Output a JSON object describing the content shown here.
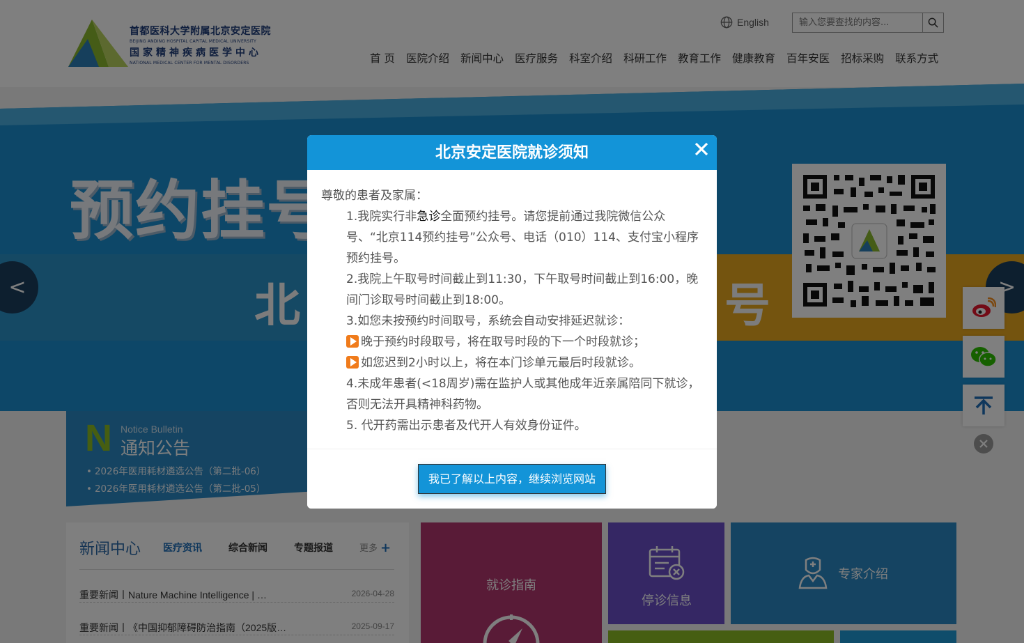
{
  "header": {
    "logo": {
      "cn_line1": "首都医科大学附属北京安定医院",
      "en_line1": "BEIJING ANDING HOSPITAL CAPITAL MEDICAL UNIVERSITY",
      "cn_line2": "国家精神疾病医学中心",
      "en_line2": "NATIONAL MEDICAL CENTER FOR MENTAL DISORDERS"
    },
    "language_label": "English",
    "search_placeholder": "输入您要查找的内容...",
    "nav": [
      "首 页",
      "医院介绍",
      "新闻中心",
      "医疗服务",
      "科室介绍",
      "科研工作",
      "教育工作",
      "健康教育",
      "百年安医",
      "招标采购",
      "联系方式"
    ]
  },
  "banner": {
    "title": "预约挂号",
    "subtitle_start": "北",
    "subtitle_end": "号",
    "prev_label": "<",
    "next_label": ">"
  },
  "notice": {
    "letter": "N",
    "title_en": "Notice Bulletin",
    "title_cn": "通知公告",
    "items": [
      "2026年医用耗材遴选公告（第二批-06）",
      "2026年医用耗材遴选公告（第二批-05）"
    ]
  },
  "news": {
    "title": "新闻中心",
    "tabs": [
      "医疗资讯",
      "综合新闻",
      "专题报道"
    ],
    "more_label": "更多",
    "more_plus": "+",
    "items": [
      {
        "title": "重要新闻丨Nature Machine Intelligence | …",
        "date": "2026-04-28"
      },
      {
        "title": "重要新闻丨《中国抑郁障碍防治指南（2025版…",
        "date": "2025-09-17"
      }
    ]
  },
  "tiles": {
    "guide": "就诊指南",
    "suspension": "停诊信息",
    "experts": "专家介绍"
  },
  "modal": {
    "title": "北京安定医院就诊须知",
    "greeting": "尊敬的患者及家属：",
    "p1_pre": "1.我院实行非",
    "p1_em": "急诊",
    "p1_post": "全面预约挂号。请您提前通过我院微信公众号、“北京114预约挂号”公众号、电话（010）114、支付宝小程序预约挂号。",
    "p2": "2.我院上午取号时间截止到11:30，下午取号时间截止到16:00，晚间门诊取号时间截止到18:00。",
    "p3": "3.如您未按预约时间取号，系统会自动安排延迟就诊：",
    "p3a": "晚于预约时段取号，将在取号时段的下一个时段就诊；",
    "p3b": "如您迟到2小时以上，将在本门诊单元最后时段就诊。",
    "p4": "4.未成年患者(<18周岁)需在监护人或其他成年近亲属陪同下就诊，否则无法开具精神科药物。",
    "p5": "5. 代开药需出示患者及代开人有效身份证件。",
    "confirm_button": "我已了解以上内容，继续浏览网站"
  }
}
